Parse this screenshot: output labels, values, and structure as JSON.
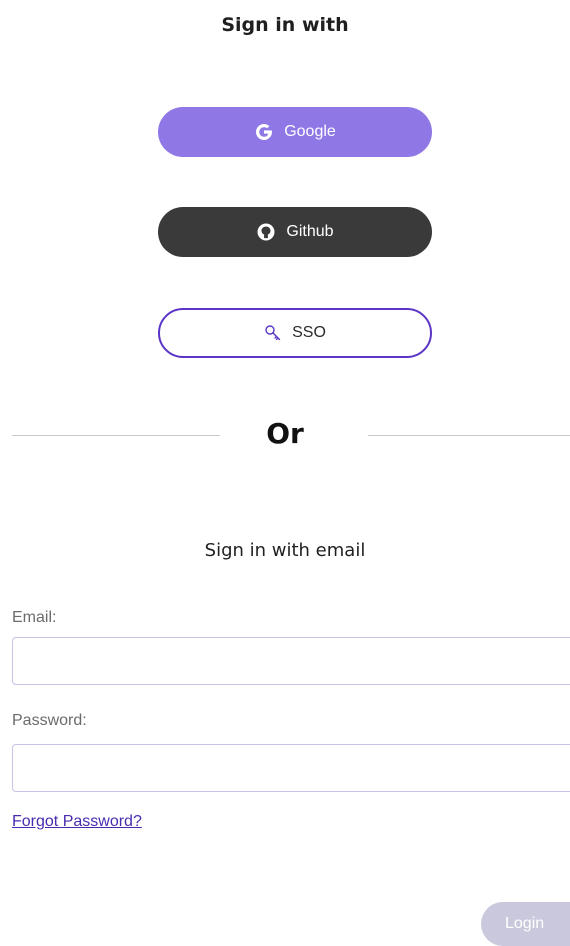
{
  "header": {
    "title": "Sign in with"
  },
  "providers": {
    "google": {
      "label": "Google",
      "icon": "google-icon",
      "color": "#8f78e6"
    },
    "github": {
      "label": "Github",
      "icon": "github-icon",
      "color": "#3a3a3a"
    },
    "sso": {
      "label": "SSO",
      "icon": "key-icon",
      "color": "#5a35c6"
    }
  },
  "divider": {
    "text": "Or"
  },
  "email_section": {
    "title": "Sign in with email",
    "email_label": "Email:",
    "email_value": "",
    "password_label": "Password:",
    "password_value": "",
    "forgot_password": "Forgot Password?",
    "login_label": "Login"
  }
}
